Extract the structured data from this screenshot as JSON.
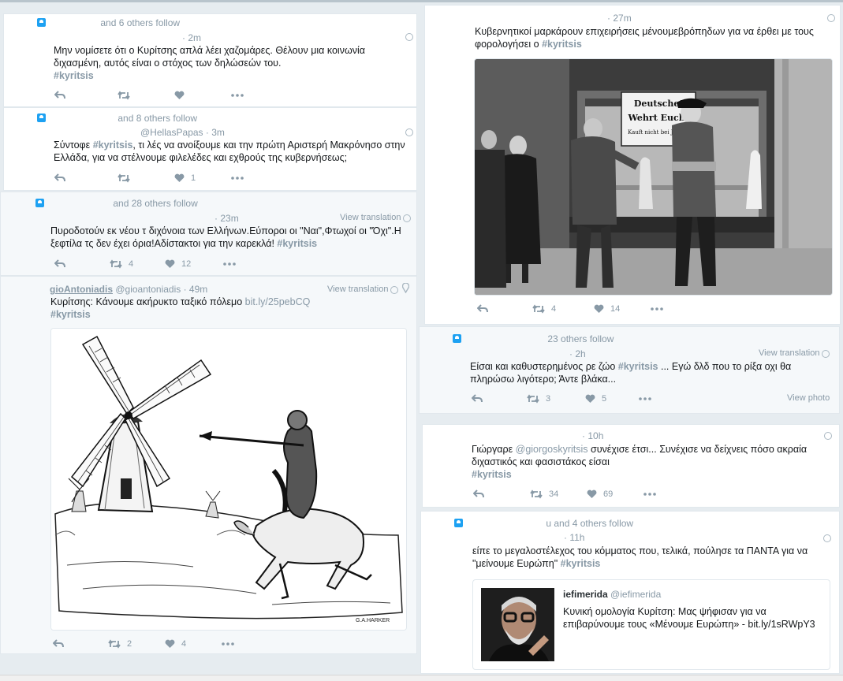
{
  "tweets": {
    "t1": {
      "context": "and 6 others follow",
      "time": "2m",
      "text": "Μην νομίσετε ότι ο Κυρίτσης απλά λέει χαζομάρες. Θέλουν μια κοινωνία διχασμένη, αυτός είναι ο στόχος των δηλώσεών του.",
      "hashtag": "#kyritsis"
    },
    "t2": {
      "context": "and 8 others follow",
      "handle": "@HellasPapas",
      "time": "3m",
      "text_a": "Σύντοφε ",
      "hashtag": "#kyritsis",
      "text_b": ", τι λές να ανοίξουμε και την πρώτη Αριστερή Μακρόνησο στην Ελλάδα, για να στέλνουμε φιλελέδες και εχθρούς της κυβερνήσεως;",
      "likes": "1"
    },
    "t3": {
      "context": "and 28 others follow",
      "time": "23m",
      "view_translation": "View translation",
      "text": "Πυροδοτούν εκ νέου τ διχόνοια των Ελλήνων.Εύποροι οι \"Ναι\",Φτωχοί οι \"Όχι\".Η ξεφτίλα τς δεν έχει όρια!Αδίστακτοι για την καρεκλά! ",
      "hashtag": "#kyritsis",
      "retweets": "4",
      "likes": "12"
    },
    "t4": {
      "name": "gioAntoniadis",
      "handle": "@gioantoniadis",
      "time": "49m",
      "view_translation": "View translation",
      "text": "Κυρίτσης: Κάνουμε ακήρυκτο ταξικό πόλεμο ",
      "link": "bit.ly/25pebCQ",
      "hashtag": "#kyritsis",
      "retweets": "2",
      "likes": "4",
      "illustration_signature": "G.A.HARKER"
    },
    "t5": {
      "time": "27m",
      "text": "Κυβερνητικοί μαρκάρουν επιχειρήσεις μένουμεβρόπηδων για να έρθει με τους φορολογήσει ο ",
      "hashtag": "#kyritsis",
      "retweets": "4",
      "likes": "14",
      "photo_sign": [
        "Deutsche!",
        "Wehrt Euch!",
        "Kauft nicht bei Juden!"
      ]
    },
    "t6": {
      "context": "23 others follow",
      "time": "2h",
      "view_translation": "View translation",
      "text_a": "Είσαι και καθυστερημένος ρε ζώο ",
      "hashtag": "#kyritsis",
      "text_b": " ... Εγώ δλδ που το ρίξα οχι θα πληρώσω λιγότερο; Άντε βλάκα...",
      "retweets": "3",
      "likes": "5",
      "view_photo": "View photo"
    },
    "t7": {
      "time": "10h",
      "text_a": "Γιώργαρε ",
      "mention": "@giorgoskyritsis",
      "text_b": " συνέχισε έτσι... Συνέχισε να δείχνεις πόσο ακραία διχαστικός και φασιστάκος είσαι",
      "hashtag": "#kyritsis",
      "retweets": "34",
      "likes": "69"
    },
    "t8": {
      "context": "u and 4 others follow",
      "time": "11h",
      "text": "είπε το μεγαλοστέλεχος του κόμματος που, τελικά, πούλησε τα ΠΑΝΤΑ για να \"μείνουμε Ευρώπη\" ",
      "hashtag": "#kyritsis",
      "quote": {
        "name": "iefimerida",
        "handle": "@iefimerida",
        "text": "Κυνική ομολογία Κυρίτση: Μας ψήφισαν για να επιβαρύνουμε τους «Μένουμε Ευρώπη» - bit.ly/1sRWpY3"
      }
    }
  },
  "colors": {
    "accent": "#1da1f2",
    "muted": "#8899a6",
    "background": "#e6ecf0"
  },
  "icons": [
    "reply-icon",
    "retweet-icon",
    "like-icon",
    "more-icon",
    "globe-icon",
    "location-icon",
    "follow-badge-icon"
  ]
}
